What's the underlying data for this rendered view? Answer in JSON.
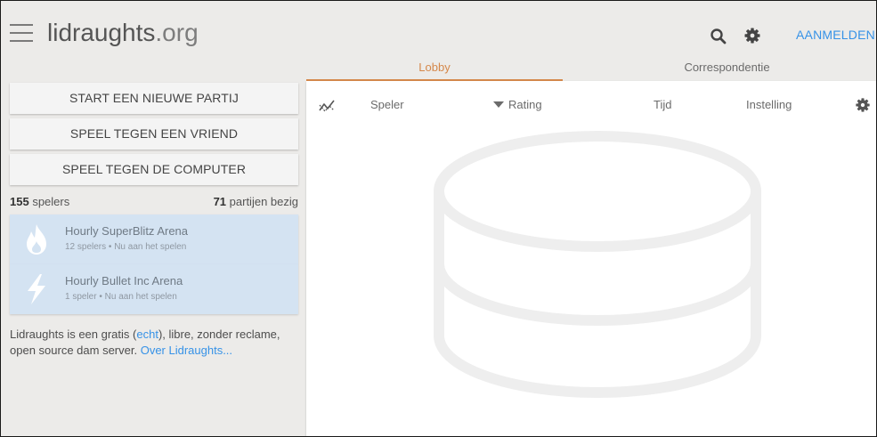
{
  "header": {
    "logo_main": "lidraughts",
    "logo_tld": ".org",
    "signin_label": "AANMELDEN",
    "icons": [
      "hamburger-icon",
      "search-icon",
      "gear-icon"
    ]
  },
  "tabs": [
    {
      "label": "Lobby",
      "active": true
    },
    {
      "label": "Correspondentie",
      "active": false
    }
  ],
  "buttons": {
    "create_game": "START EEN NIEUWE PARTIJ",
    "play_friend": "SPEEL TEGEN EEN VRIEND",
    "play_computer": "SPEEL TEGEN DE COMPUTER"
  },
  "counts": {
    "players_num": "155",
    "players_label": " spelers",
    "games_num": "71",
    "games_label": " partijen bezig"
  },
  "tournaments": [
    {
      "name": "Hourly SuperBlitz Arena",
      "info": "12 spelers • Nu aan het spelen",
      "icon": "flame-icon"
    },
    {
      "name": "Hourly Bullet Inc Arena",
      "info": "1 speler • Nu aan het spelen",
      "icon": "lightning-icon"
    }
  ],
  "about": {
    "text_1": "Lidraughts is een gratis (",
    "link_free": "echt",
    "text_2": "), libre, zonder reclame, open source dam server. ",
    "link_about": "Over Lidraughts..."
  },
  "lobby_table": {
    "columns": [
      "Speler",
      "Rating",
      "Tijd",
      "Instelling"
    ],
    "sorted_column": "Rating",
    "icons": [
      "graph-icon",
      "gear-icon",
      "empty-database-icon"
    ]
  },
  "colors": {
    "accent": "#d5884b",
    "link": "#3692e7",
    "tournament_bg": "#d4e3f2",
    "page_bg": "#ecebe9"
  }
}
